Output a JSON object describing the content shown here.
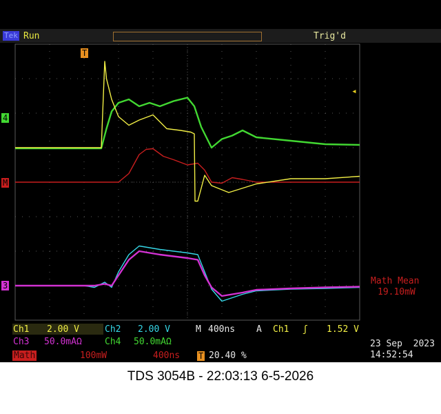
{
  "header": {
    "logo": "Tek",
    "run_state": "Run",
    "trig_state": "Trig'd"
  },
  "colors": {
    "ch1": "#f2ef45",
    "ch2": "#36d8e8",
    "ch3": "#d332d3",
    "ch4": "#42d832",
    "math": "#c81e1e",
    "grid": "#5a5a5a",
    "label_bg": "#ffffff"
  },
  "markers": {
    "ch4": "4",
    "math": "M",
    "ch3": "3",
    "trigger": "T"
  },
  "math_readout": {
    "label": "Math Mean",
    "value": "19.10mW"
  },
  "status": {
    "row1": {
      "ch1_label": "Ch1",
      "ch1_scale": "2.00 V",
      "ch2_label": "Ch2",
      "ch2_scale": "2.00 V",
      "timebase_label": "M",
      "timebase_value": "400ns",
      "trigger_mode": "A",
      "trigger_source": "Ch1",
      "trigger_slope": "ʃ",
      "trigger_level": "1.52 V"
    },
    "row2": {
      "ch3_label": "Ch3",
      "ch3_scale": "50.0mAΩ",
      "ch4_label": "Ch4",
      "ch4_scale": "50.0mAΩ"
    },
    "row3": {
      "math_label": "Math",
      "math_scale": "100mW",
      "math_time": "400ns",
      "trigger_icon": "T",
      "trigger_pos": "20.40 %"
    },
    "date": "23 Sep  2023",
    "time": "14:52:54"
  },
  "caption": "TDS 3054B - 22:03:13   6-5-2026",
  "chart_data": {
    "type": "line",
    "grid": true,
    "x_divisions": 10,
    "y_divisions": 8,
    "x_range": [
      0,
      10
    ],
    "y_range": [
      -4,
      4
    ],
    "series": [
      {
        "name": "Ch1",
        "x": [
          0,
          2.5,
          2.6,
          2.65,
          2.8,
          3.0,
          3.3,
          3.6,
          4.0,
          4.4,
          4.8,
          5.1,
          5.2,
          5.22,
          5.3,
          5.5,
          5.7,
          6.2,
          7.0,
          8.0,
          9.0,
          10.0
        ],
        "y": [
          1.0,
          1.0,
          3.5,
          3.0,
          2.4,
          1.9,
          1.65,
          1.8,
          1.95,
          1.55,
          1.5,
          1.45,
          1.4,
          -0.55,
          -0.55,
          0.2,
          -0.1,
          -0.3,
          -0.05,
          0.1,
          0.1,
          0.17
        ]
      },
      {
        "name": "Ch4",
        "x": [
          0,
          2.5,
          2.65,
          2.8,
          3.0,
          3.3,
          3.6,
          3.9,
          4.2,
          4.6,
          5.0,
          5.2,
          5.4,
          5.7,
          6.0,
          6.3,
          6.6,
          7.0,
          8.0,
          9.0,
          10.0
        ],
        "y": [
          0.98,
          0.98,
          1.55,
          2.05,
          2.3,
          2.4,
          2.2,
          2.3,
          2.2,
          2.35,
          2.45,
          2.2,
          1.6,
          1.0,
          1.25,
          1.35,
          1.5,
          1.3,
          1.2,
          1.1,
          1.08
        ]
      },
      {
        "name": "Math",
        "x": [
          0,
          2.6,
          3.0,
          3.3,
          3.6,
          3.8,
          4.0,
          4.3,
          4.6,
          5.0,
          5.3,
          5.5,
          5.7,
          6.0,
          6.3,
          6.6,
          7.0,
          8.0,
          10.0
        ],
        "y": [
          0,
          0,
          0.0,
          0.25,
          0.8,
          0.95,
          0.97,
          0.75,
          0.65,
          0.5,
          0.55,
          0.35,
          0.0,
          -0.03,
          0.13,
          0.08,
          0.0,
          0.0,
          0.0
        ]
      },
      {
        "name": "Ch2",
        "x": [
          0,
          2.0,
          2.3,
          2.6,
          2.8,
          3.0,
          3.3,
          3.6,
          3.9,
          4.2,
          4.6,
          5.0,
          5.3,
          5.5,
          5.7,
          6.0,
          6.3,
          6.6,
          7.0,
          8.0,
          9.0,
          10.0
        ],
        "y": [
          -3.0,
          -3.0,
          -3.05,
          -2.9,
          -3.05,
          -2.6,
          -2.1,
          -1.85,
          -1.9,
          -1.95,
          -2.0,
          -2.05,
          -2.1,
          -2.6,
          -3.1,
          -3.45,
          -3.35,
          -3.25,
          -3.15,
          -3.1,
          -3.08,
          -3.05
        ]
      },
      {
        "name": "Ch3",
        "x": [
          0,
          2.0,
          2.3,
          2.6,
          2.8,
          3.0,
          3.3,
          3.6,
          3.9,
          4.2,
          4.6,
          5.0,
          5.3,
          5.5,
          5.7,
          6.0,
          6.3,
          6.6,
          7.0,
          8.0,
          9.0,
          10.0
        ],
        "y": [
          -3.0,
          -3.0,
          -3.0,
          -2.95,
          -3.0,
          -2.7,
          -2.25,
          -2.0,
          -2.05,
          -2.1,
          -2.15,
          -2.2,
          -2.25,
          -2.7,
          -3.05,
          -3.3,
          -3.25,
          -3.2,
          -3.12,
          -3.08,
          -3.05,
          -3.03
        ]
      }
    ]
  }
}
